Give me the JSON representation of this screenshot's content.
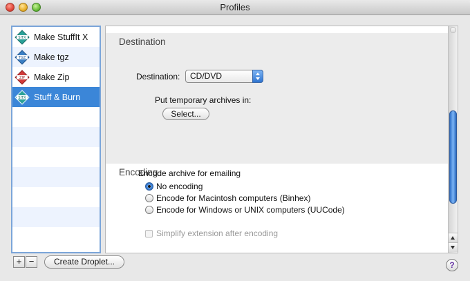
{
  "window": {
    "title": "Profiles"
  },
  "sidebar": {
    "items": [
      {
        "label": "Make StuffIt X",
        "icon": "stuffit-x-icon",
        "badge": "SITX",
        "color": "#2aa198"
      },
      {
        "label": "Make tgz",
        "icon": "tgz-icon",
        "badge": "TGZ",
        "color": "#3b7fc4"
      },
      {
        "label": "Make Zip",
        "icon": "zip-icon",
        "badge": "ZIP",
        "color": "#d13a3a"
      },
      {
        "label": "Stuff & Burn",
        "icon": "stuffit-burn-icon",
        "badge": "SITX",
        "color": "#2aa198",
        "selected": true
      }
    ]
  },
  "toolbar": {
    "add_label": "+",
    "remove_label": "−",
    "create_droplet_label": "Create Droplet..."
  },
  "destination": {
    "section_title": "Destination",
    "destination_label": "Destination:",
    "destination_value": "CD/DVD",
    "temp_label": "Put temporary archives in:",
    "select_label": "Select..."
  },
  "encoding": {
    "section_title": "Encoding",
    "heading": "Encode archive for emailing",
    "options": [
      {
        "label": "No encoding",
        "selected": true
      },
      {
        "label": "Encode for Macintosh computers (Binhex)",
        "selected": false
      },
      {
        "label": "Encode for Windows or UNIX computers (UUCode)",
        "selected": false
      }
    ],
    "simplify_label": "Simplify extension after encoding"
  },
  "help": {
    "label": "?"
  }
}
